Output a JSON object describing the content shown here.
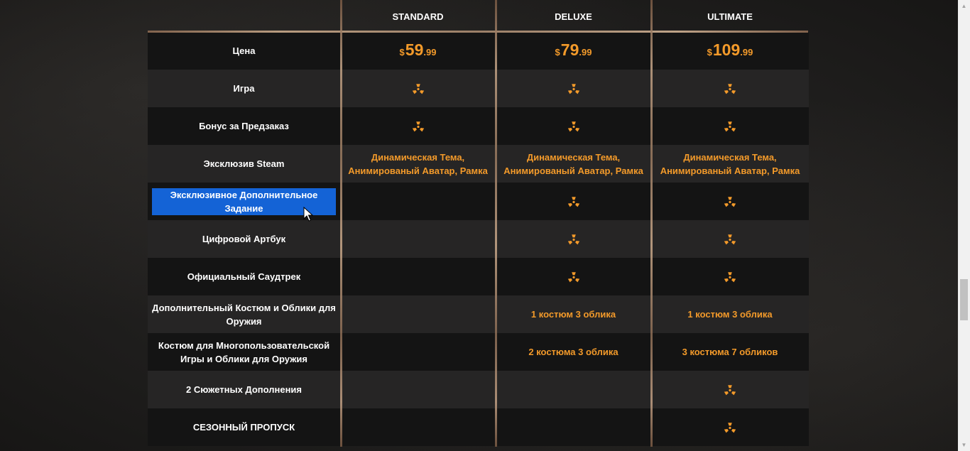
{
  "colors": {
    "accent": "#f39a2a",
    "selection": "#1463d6",
    "row_dark": "#141414",
    "row_light": "#262525",
    "divider": "#c9a98a"
  },
  "header": {
    "editions": [
      "STANDARD",
      "DELUXE",
      "ULTIMATE"
    ]
  },
  "prices": [
    {
      "currency": "$",
      "main": "59",
      "cents": ".99"
    },
    {
      "currency": "$",
      "main": "79",
      "cents": ".99"
    },
    {
      "currency": "$",
      "main": "109",
      "cents": ".99"
    }
  ],
  "rows": [
    {
      "label": "Цена",
      "kind": "price"
    },
    {
      "label": "Игра",
      "cells": [
        "radiation-icon",
        "radiation-icon",
        "radiation-icon"
      ]
    },
    {
      "label": "Бонус за Предзаказ",
      "cells": [
        "radiation-icon",
        "radiation-icon",
        "radiation-icon"
      ]
    },
    {
      "label": "Эксклюзив Steam",
      "cells": [
        "Динамическая Тема, Анимированый Аватар, Рамка",
        "Динамическая Тема, Анимированый Аватар, Рамка",
        "Динамическая Тема, Анимированый Аватар, Рамка"
      ]
    },
    {
      "label": "Эксклюзивное Дополнительное Задание",
      "selected": true,
      "cells": [
        "",
        "radiation-icon",
        "radiation-icon"
      ]
    },
    {
      "label": "Цифровой Артбук",
      "cells": [
        "",
        "radiation-icon",
        "radiation-icon"
      ]
    },
    {
      "label": "Официальный Саудтрек",
      "cells": [
        "",
        "radiation-icon",
        "radiation-icon"
      ]
    },
    {
      "label": "Дополнительный Костюм и Облики для Оружия",
      "cells": [
        "",
        "1 костюм 3 облика",
        "1 костюм 3 облика"
      ]
    },
    {
      "label": "Костюм для Многопользовательской Игры и Облики для Оружия",
      "cells": [
        "",
        "2 костюма 3 облика",
        "3 костюма 7 обликов"
      ]
    },
    {
      "label": "2 Сюжетных Дополнения",
      "cells": [
        "",
        "",
        "radiation-icon"
      ]
    },
    {
      "label": "СЕЗОННЫЙ ПРОПУСК",
      "cells": [
        "",
        "",
        "radiation-icon"
      ]
    }
  ],
  "scrollbar": {
    "up_icon": "scroll-up-arrow-icon",
    "down_icon": "scroll-down-arrow-icon"
  }
}
